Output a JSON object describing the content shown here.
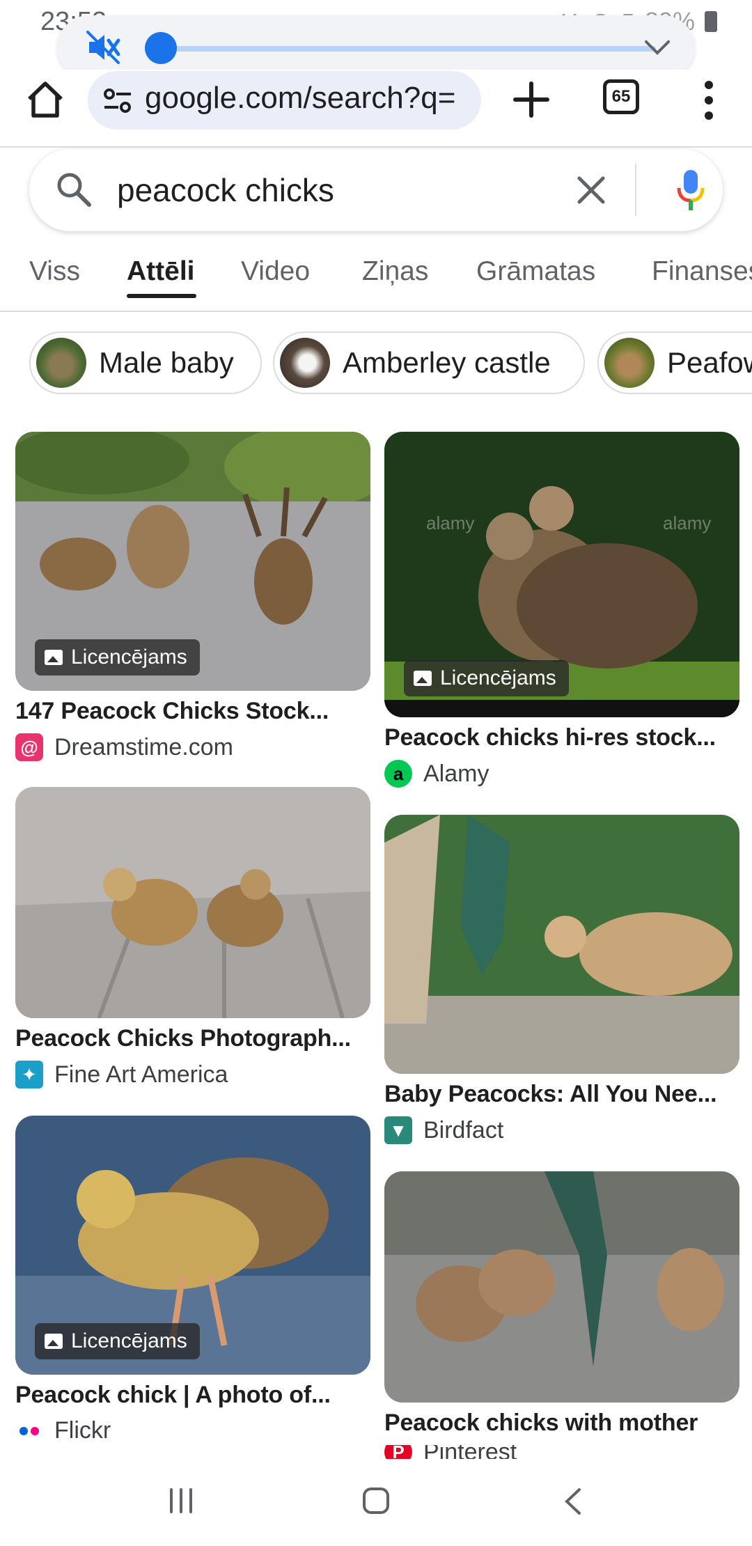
{
  "status": {
    "time": "23:53",
    "battery": "89%"
  },
  "browser": {
    "url": "google.com/search?q=",
    "tab_count": "65"
  },
  "search": {
    "query": "peacock chicks"
  },
  "tabs": [
    {
      "label": "Viss"
    },
    {
      "label": "Attēli",
      "active": true
    },
    {
      "label": "Video"
    },
    {
      "label": "Ziņas"
    },
    {
      "label": "Grāmatas"
    },
    {
      "label": "Finanses"
    }
  ],
  "chips": [
    {
      "label": "Male baby"
    },
    {
      "label": "Amberley castle"
    },
    {
      "label": "Peafowl"
    }
  ],
  "results": [
    {
      "title": "147 Peacock Chicks Stock...",
      "source": "Dreamstime.com",
      "badge": "Licencējams",
      "source_icon": "dreamstime-swirl-icon"
    },
    {
      "title": "Peacock chicks hi-res stock...",
      "source": "Alamy",
      "badge": "Licencējams",
      "source_icon": "alamy-a-icon",
      "watermark": "alamy"
    },
    {
      "title": "Peacock Chicks Photograph...",
      "source": "Fine Art America",
      "source_icon": "fineartamerica-icon"
    },
    {
      "title": "Baby Peacocks: All You Nee...",
      "source": "Birdfact",
      "source_icon": "birdfact-icon"
    },
    {
      "title": "Peacock chick | A photo of...",
      "source": "Flickr",
      "badge": "Licencējams",
      "source_icon": "flickr-dots-icon"
    },
    {
      "title": "Peacock chicks with mother",
      "source": "Pinterest",
      "source_icon": "pinterest-icon"
    }
  ],
  "colors": {
    "accent": "#1a73e8",
    "volume_track": "#b9d3f6",
    "urlbar_bg": "#e9eef9"
  }
}
